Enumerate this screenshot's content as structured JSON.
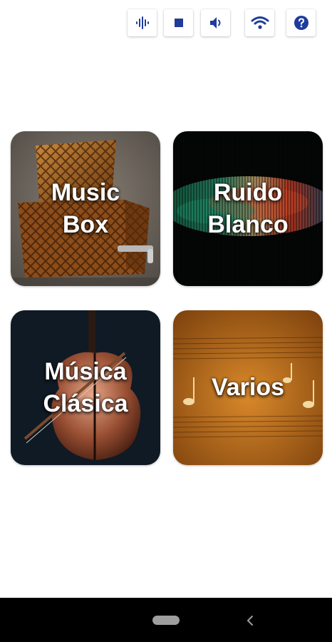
{
  "toolbar": {
    "buttons": [
      {
        "name": "voice-wave-button",
        "icon": "sound-wave-icon"
      },
      {
        "name": "stop-button",
        "icon": "stop-square-icon"
      },
      {
        "name": "volume-button",
        "icon": "speaker-icon"
      },
      {
        "name": "wifi-button",
        "icon": "wifi-icon"
      },
      {
        "name": "help-button",
        "icon": "help-circle-icon"
      }
    ],
    "accent_color": "#1f3c9b"
  },
  "categories": [
    {
      "label": "Music\nBox"
    },
    {
      "label": "Ruido\nBlanco"
    },
    {
      "label": "Música\nClásica"
    },
    {
      "label": "Varios"
    }
  ],
  "navbar": {
    "home_icon": "home-pill-icon",
    "back_icon": "back-chevron-icon"
  }
}
